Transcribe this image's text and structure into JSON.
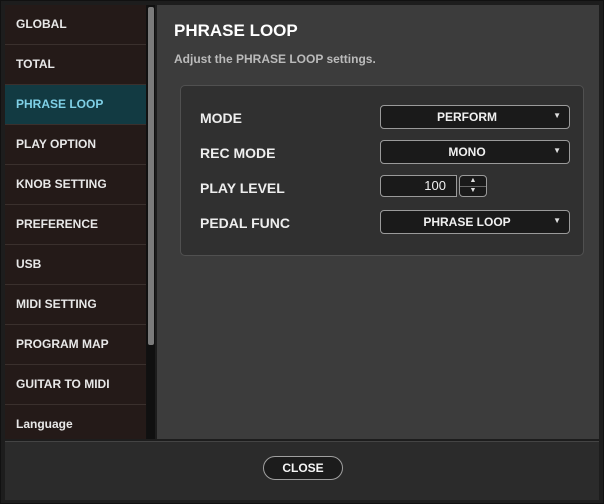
{
  "sidebar": {
    "items": [
      {
        "label": "GLOBAL"
      },
      {
        "label": "TOTAL"
      },
      {
        "label": "PHRASE LOOP"
      },
      {
        "label": "PLAY OPTION"
      },
      {
        "label": "KNOB SETTING"
      },
      {
        "label": "PREFERENCE"
      },
      {
        "label": "USB"
      },
      {
        "label": "MIDI SETTING"
      },
      {
        "label": "PROGRAM MAP"
      },
      {
        "label": "GUITAR TO MIDI"
      },
      {
        "label": "Language"
      }
    ],
    "active_index": 2
  },
  "content": {
    "title": "PHRASE LOOP",
    "subtitle": "Adjust the PHRASE LOOP settings.",
    "rows": [
      {
        "label": "MODE",
        "value": "PERFORM"
      },
      {
        "label": "REC MODE",
        "value": "MONO"
      },
      {
        "label": "PLAY LEVEL",
        "value": "100"
      },
      {
        "label": "PEDAL FUNC",
        "value": "PHRASE LOOP"
      }
    ]
  },
  "footer": {
    "close_label": "CLOSE"
  },
  "icons": {
    "dropdown": "chevron-down-icon",
    "spin_up": "chevron-up-icon",
    "spin_down": "chevron-down-icon"
  },
  "colors": {
    "active_item_bg": "#123a42",
    "active_item_text": "#7fd0e6"
  }
}
